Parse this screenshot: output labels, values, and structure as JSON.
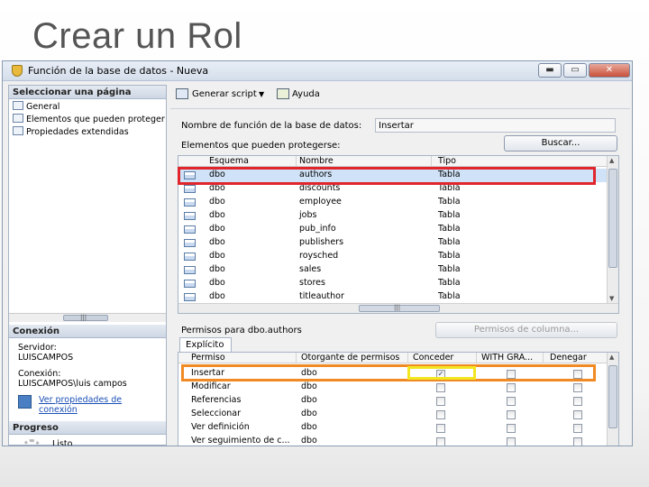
{
  "slide_title": "Crear un Rol",
  "window": {
    "title": "Función de la base de datos - Nueva",
    "min_label": "▬",
    "max_label": "▭",
    "close_label": "✕"
  },
  "nav": {
    "header": "Seleccionar una página",
    "items": [
      "General",
      "Elementos que pueden proteger",
      "Propiedades extendidas"
    ],
    "scroll_label": "|||"
  },
  "connection": {
    "header": "Conexión",
    "server_label": "Servidor:",
    "server_value": "LUISCAMPOS",
    "conn_label": "Conexión:",
    "conn_value": "LUISCAMPOS\\luis campos",
    "link": "Ver propiedades de conexión"
  },
  "progress": {
    "header": "Progreso",
    "status": "Listo"
  },
  "toolbar": {
    "script_label": "Generar script",
    "help_label": "Ayuda"
  },
  "role_name": {
    "label": "Nombre de función de la base de datos:",
    "value": "Insertar"
  },
  "securables": {
    "label": "Elementos que pueden protegerse:",
    "search_button": "Buscar...",
    "columns": [
      "Esquema",
      "Nombre",
      "Tipo"
    ],
    "rows": [
      [
        "dbo",
        "authors",
        "Tabla"
      ],
      [
        "dbo",
        "discounts",
        "Tabla"
      ],
      [
        "dbo",
        "employee",
        "Tabla"
      ],
      [
        "dbo",
        "jobs",
        "Tabla"
      ],
      [
        "dbo",
        "pub_info",
        "Tabla"
      ],
      [
        "dbo",
        "publishers",
        "Tabla"
      ],
      [
        "dbo",
        "roysched",
        "Tabla"
      ],
      [
        "dbo",
        "sales",
        "Tabla"
      ],
      [
        "dbo",
        "stores",
        "Tabla"
      ],
      [
        "dbo",
        "titleauthor",
        "Tabla"
      ]
    ],
    "scroll_label": "|||"
  },
  "permissions": {
    "label": "Permisos para dbo.authors",
    "column_perms_button": "Permisos de columna...",
    "tab_label": "Explícito",
    "columns": [
      "Permiso",
      "Otorgante de permisos",
      "Conceder",
      "WITH GRA...",
      "Denegar"
    ],
    "rows": [
      {
        "perm": "Insertar",
        "grantor": "dbo",
        "grant": true,
        "with_grant": false,
        "deny": false
      },
      {
        "perm": "Modificar",
        "grantor": "dbo",
        "grant": false,
        "with_grant": false,
        "deny": false
      },
      {
        "perm": "Referencias",
        "grantor": "dbo",
        "grant": false,
        "with_grant": false,
        "deny": false
      },
      {
        "perm": "Seleccionar",
        "grantor": "dbo",
        "grant": false,
        "with_grant": false,
        "deny": false
      },
      {
        "perm": "Ver definición",
        "grantor": "dbo",
        "grant": false,
        "with_grant": false,
        "deny": false
      },
      {
        "perm": "Ver seguimiento de c...",
        "grantor": "dbo",
        "grant": false,
        "with_grant": false,
        "deny": false
      }
    ],
    "check_mark": "✓"
  },
  "colors": {
    "highlight_red": "#e0262c",
    "highlight_orange": "#f08a24",
    "highlight_yellow": "#f2e620"
  }
}
